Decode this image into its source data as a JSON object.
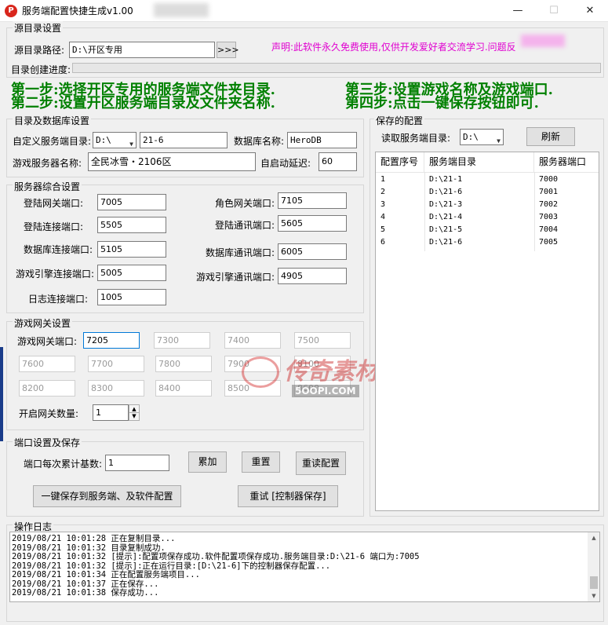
{
  "window": {
    "title": "服务端配置快捷生成v1.00",
    "minimize": "—",
    "maximize": "☐",
    "close": "✕"
  },
  "source_group": {
    "label": "源目录设置",
    "path_label": "源目录路径:",
    "path_value": "D:\\开区专用",
    "browse_label": ">>>",
    "notice": "声明:此软件永久免费使用,仅供开发爱好者交流学习.问题反",
    "progress_label": "目录创建进度:",
    "progress": 0
  },
  "steps": [
    "第一步:选择开区专用的服务端文件夹目录.",
    "第二步:设置开区服务端目录及文件夹名称.",
    "第三步:设置游戏名称及游戏端口.",
    "第四步:点击一键保存按钮即可."
  ],
  "dir_group": {
    "label": "目录及数据库设置",
    "custom_dir_label": "自定义服务端目录:",
    "drive_value": "D:\\",
    "folder_value": "21-6",
    "db_name_label": "数据库名称:",
    "db_name_value": "HeroDB",
    "server_name_label": "游戏服务器名称:",
    "server_name_value": "全民冰雪・2106区",
    "autostart_label": "自启动延迟:",
    "autostart_value": "60"
  },
  "ports_group": {
    "label": "服务器综合设置",
    "fields": [
      {
        "label": "登陆网关端口:",
        "value": "7005"
      },
      {
        "label": "角色网关端口:",
        "value": "7105"
      },
      {
        "label": "登陆连接端口:",
        "value": "5505"
      },
      {
        "label": "登陆通讯端口:",
        "value": "5605"
      },
      {
        "label": "数据库连接端口:",
        "value": "5105"
      },
      {
        "label": "数据库通讯端口:",
        "value": "6005"
      },
      {
        "label": "游戏引擎连接端口:",
        "value": "5005"
      },
      {
        "label": "游戏引擎通讯端口:",
        "value": "4905"
      },
      {
        "label": "日志连接端口:",
        "value": "1005"
      }
    ]
  },
  "gateway_group": {
    "label": "游戏网关设置",
    "port_label": "游戏网关端口:",
    "ports": [
      "7205",
      "7300",
      "7400",
      "7500",
      "7600",
      "7700",
      "7800",
      "7900",
      "8100",
      "8200",
      "8300",
      "8400",
      "8500",
      "8600"
    ],
    "count_label": "开启网关数量:",
    "count_value": "1"
  },
  "save_group": {
    "label": "端口设置及保存",
    "base_label": "端口每次累计基数:",
    "base_value": "1",
    "add_button": "累加",
    "reset_button": "重置",
    "reload_button": "重读配置",
    "save_all_button": "一键保存到服务端、及软件配置",
    "retry_button": "重试 [控制器保存]"
  },
  "saved_group": {
    "label": "保存的配置",
    "read_label": "读取服务端目录:",
    "drive_value": "D:\\",
    "refresh_button": "刷新",
    "columns": [
      "配置序号",
      "服务端目录",
      "服务器端口"
    ],
    "rows": [
      [
        "1",
        "D:\\21-1",
        "7000"
      ],
      [
        "2",
        "D:\\21-6",
        "7001"
      ],
      [
        "3",
        "D:\\21-3",
        "7002"
      ],
      [
        "4",
        "D:\\21-4",
        "7003"
      ],
      [
        "5",
        "D:\\21-5",
        "7004"
      ],
      [
        "6",
        "D:\\21-6",
        "7005"
      ]
    ]
  },
  "log_group": {
    "label": "操作日志",
    "lines": [
      "2019/08/21 10:01:28  正在复制目录...",
      "2019/08/21 10:01:32  目录复制成功.",
      "2019/08/21 10:01:32  [提示]:配置项保存成功.软件配置项保存成功.服务端目录:D:\\21-6  端口为:7005",
      "2019/08/21 10:01:32  [提示]:正在运行目录:[D:\\21-6]下的控制器保存配置...",
      "2019/08/21 10:01:34  正在配置服务端项目...",
      "2019/08/21 10:01:37  正在保存...",
      "2019/08/21 10:01:38  保存成功..."
    ]
  },
  "watermark": {
    "brand": "传奇素材",
    "site": "5OOPI.COM"
  },
  "colors": {
    "steps": "#008000",
    "notice": "#e000d0",
    "accent": "#0078d7"
  }
}
